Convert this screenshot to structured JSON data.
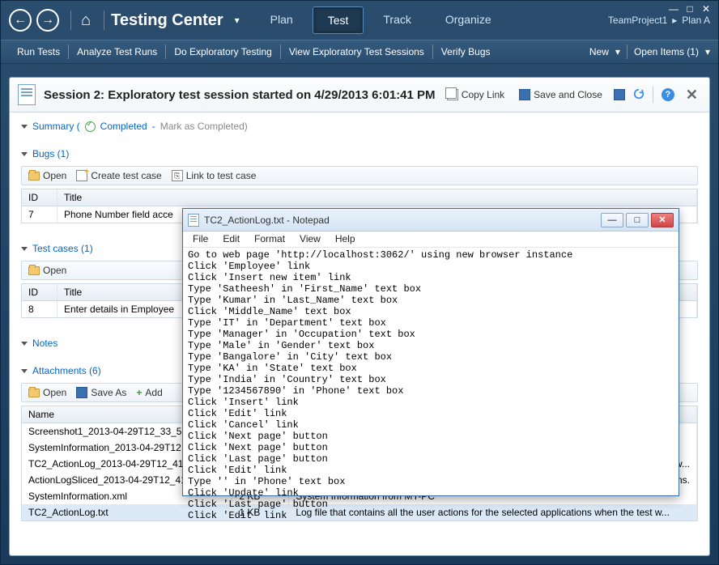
{
  "window": {
    "app_title": "Testing Center",
    "project": "TeamProject1",
    "plan": "Plan A"
  },
  "main_tabs": [
    "Plan",
    "Test",
    "Track",
    "Organize"
  ],
  "main_tab_active": 1,
  "subbar": {
    "items": [
      "Run Tests",
      "Analyze Test Runs",
      "Do Exploratory Testing",
      "View Exploratory Test Sessions",
      "Verify Bugs"
    ],
    "right": {
      "new": "New",
      "open_items": "Open Items (1)"
    }
  },
  "session": {
    "title": "Session 2: Exploratory test session started on 4/29/2013 6:01:41 PM",
    "copy_link": "Copy Link",
    "save_close": "Save and Close"
  },
  "summary_section": {
    "label": "Summary (",
    "status": "Completed",
    "mark": "Mark as Completed)"
  },
  "bugs_section": {
    "label": "Bugs (1)",
    "toolbar": {
      "open": "Open",
      "create": "Create test case",
      "link": "Link to test case"
    },
    "columns": {
      "id": "ID",
      "title": "Title"
    },
    "rows": [
      {
        "id": "7",
        "title": "Phone Number field acce"
      }
    ]
  },
  "tests_section": {
    "label": "Test cases (1)",
    "toolbar": {
      "open": "Open"
    },
    "columns": {
      "id": "ID",
      "title": "Title"
    },
    "rows": [
      {
        "id": "8",
        "title": "Enter details in Employee"
      }
    ]
  },
  "notes_section": {
    "label": "Notes"
  },
  "attachments_section": {
    "label": "Attachments (6)",
    "toolbar": {
      "open": "Open",
      "saveas": "Save As",
      "add": "Add"
    },
    "columns": {
      "name": "Name",
      "size": "",
      "desc": ""
    },
    "rows": [
      {
        "name": "Screenshot1_2013-04-29T12_33_55.",
        "size": "",
        "desc": ""
      },
      {
        "name": "SystemInformation_2013-04-29T12",
        "size": "",
        "desc": ""
      },
      {
        "name": "TC2_ActionLog_2013-04-29T12_41_",
        "size": "",
        "desc": "est w..."
      },
      {
        "name": "ActionLogSliced_2013-04-29T12_41",
        "size": "",
        "desc": "ons."
      },
      {
        "name": "SystemInformation.xml",
        "size": "2 KB",
        "desc": "System Information from MY-PC"
      },
      {
        "name": "TC2_ActionLog.txt",
        "size": "1 KB",
        "desc": "Log file that contains all the user actions for the selected applications when the test w..."
      }
    ]
  },
  "notepad": {
    "title": "TC2_ActionLog.txt - Notepad",
    "menus": [
      "File",
      "Edit",
      "Format",
      "View",
      "Help"
    ],
    "body": "Go to web page 'http://localhost:3062/' using new browser instance\nClick 'Employee' link\nClick 'Insert new item' link\nType 'Satheesh' in 'First_Name' text box\nType 'Kumar' in 'Last_Name' text box\nClick 'Middle_Name' text box\nType 'IT' in 'Department' text box\nType 'Manager' in 'Occupation' text box\nType 'Male' in 'Gender' text box\nType 'Bangalore' in 'City' text box\nType 'KA' in 'State' text box\nType 'India' in 'Country' text box\nType '1234567890' in 'Phone' text box\nClick 'Insert' link\nClick 'Edit' link\nClick 'Cancel' link\nClick 'Next page' button\nClick 'Next page' button\nClick 'Last page' button\nClick 'Edit' link\nType '' in 'Phone' text box\nClick 'Update' link\nClick 'Last page' button\nClick 'Edit' link"
  }
}
